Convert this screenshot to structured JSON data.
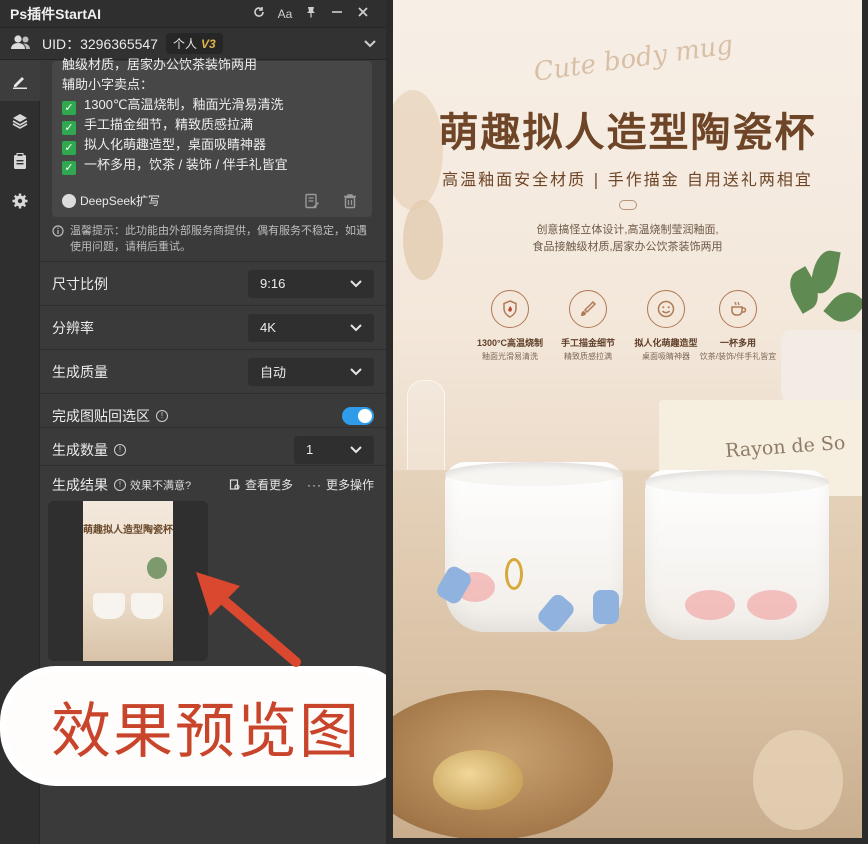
{
  "window": {
    "title": "Ps插件StartAI",
    "controls": [
      "refresh-icon",
      "font-size-icon",
      "pin-icon",
      "minimize-icon",
      "close-icon"
    ],
    "font_button_label": "Aa"
  },
  "user": {
    "uid_text": "UID：3296365547",
    "plan_label": "个人",
    "version_badge": "V3"
  },
  "sidebar": {
    "items": [
      {
        "icon": "edit-icon",
        "active": true
      },
      {
        "icon": "layers-icon",
        "active": false
      },
      {
        "icon": "clipboard-icon",
        "active": false
      },
      {
        "icon": "gear-icon",
        "active": false
      }
    ]
  },
  "copy_card": {
    "cut_line": "触级材质，居家办公饮茶装饰两用",
    "heading": "辅助小字卖点：",
    "points": [
      "1300℃高温烧制，釉面光滑易清洗",
      "手工描金细节，精致质感拉满",
      "拟人化萌趣造型，桌面吸睛神器",
      "一杯多用，饮茶 / 装饰 / 伴手礼皆宜"
    ],
    "deepseek_label": "DeepSeek扩写"
  },
  "tip": "温馨提示：此功能由外部服务商提供，偶有服务不稳定，如遇使用问题，请稍后重试。",
  "settings": {
    "aspect_label": "尺寸比例",
    "aspect_value": "9:16",
    "resolution_label": "分辨率",
    "resolution_value": "4K",
    "quality_label": "生成质量",
    "quality_value": "自动",
    "paste_back_label": "完成图贴回选区",
    "paste_back_on": true,
    "count_label": "生成数量",
    "count_value": "1"
  },
  "results": {
    "label": "生成结果",
    "unsatisfied": "效果不满意?",
    "view_more": "查看更多",
    "more_ops": "更多操作",
    "thumb_title": "萌趣拟人造型陶瓷杯"
  },
  "callout": "效果预览图",
  "poster": {
    "script": "Cute body mug",
    "title": "萌趣拟人造型陶瓷杯",
    "subtitle": "高温釉面安全材质 | 手作描金 自用送礼两相宜",
    "desc_line1": "创意搞怪立体设计,高温烧制莹润釉面,",
    "desc_line2": "食品接触级材质,居家办公饮茶装饰两用",
    "features": [
      {
        "icon": "shield-fire-icon",
        "title": "1300°C高温烧制",
        "sub": "釉面光滑易清洗"
      },
      {
        "icon": "brush-icon",
        "title": "手工描金细节",
        "sub": "精致质感拉满"
      },
      {
        "icon": "smile-icon",
        "title": "拟人化萌趣造型",
        "sub": "桌面吸睛神器"
      },
      {
        "icon": "cup-icon",
        "title": "一杯多用",
        "sub": "饮茶/装饰/伴手礼皆宜"
      }
    ],
    "book_text": "Rayon de So"
  },
  "colors": {
    "panel_bg": "#3a3a3a",
    "check_green": "#2fa84f",
    "toggle_blue": "#2e9ce8",
    "callout_red": "#c8452b",
    "poster_brown": "#6e4527"
  }
}
